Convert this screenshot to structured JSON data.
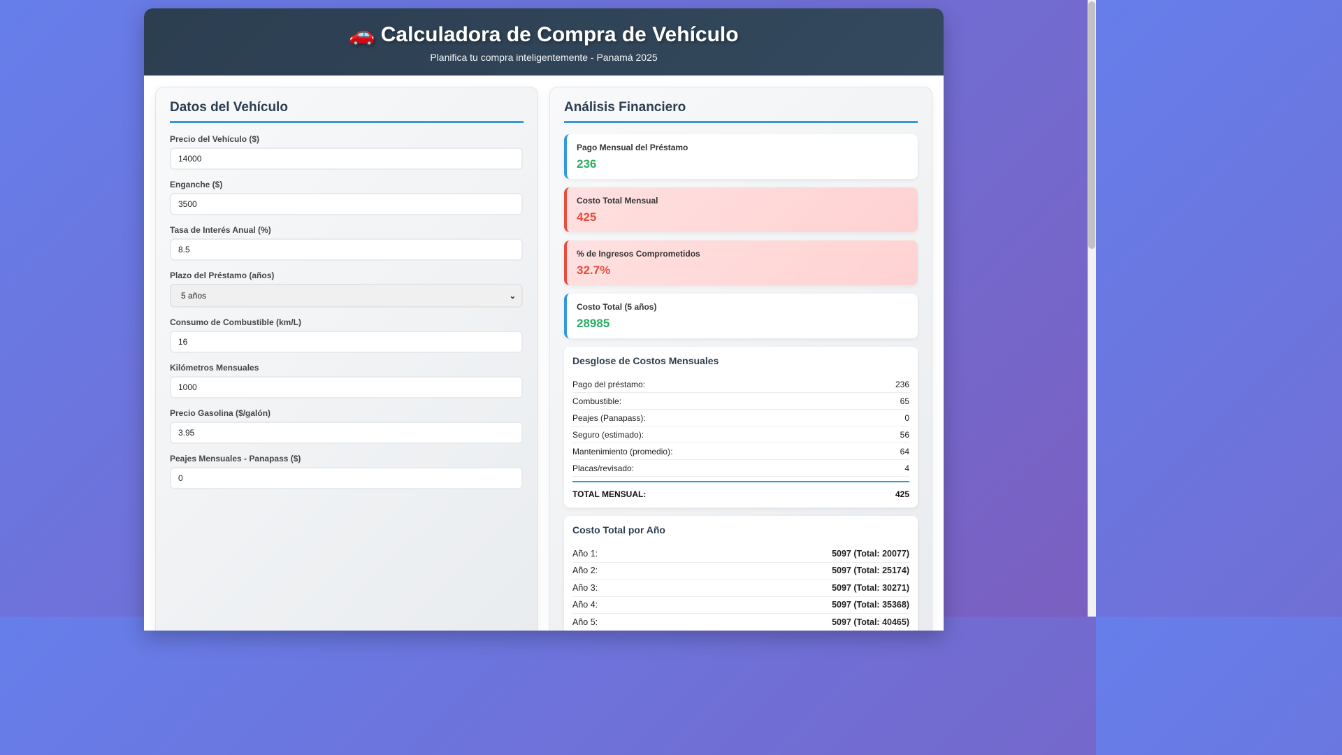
{
  "header": {
    "icon": "car-icon",
    "title": "Calculadora de Compra de Vehículo",
    "subtitle": "Planifica tu compra inteligentemente - Panamá 2025"
  },
  "vehicle_panel": {
    "heading": "Datos del Vehículo",
    "fields": [
      {
        "label": "Precio del Vehículo ($)",
        "value": "14000"
      },
      {
        "label": "Enganche ($)",
        "value": "3500"
      },
      {
        "label": "Tasa de Interés Anual (%)",
        "value": "8.5"
      },
      {
        "label": "Plazo del Préstamo (años)",
        "value": "5 años"
      },
      {
        "label": "Consumo de Combustible (km/L)",
        "value": "16"
      },
      {
        "label": "Kilómetros Mensuales",
        "value": "1000"
      },
      {
        "label": "Precio Gasolina ($/galón)",
        "value": "3.95"
      },
      {
        "label": "Peajes Mensuales - Panapass ($)",
        "value": "0"
      }
    ]
  },
  "analysis_panel": {
    "heading": "Análisis Financiero",
    "cards": [
      {
        "title": "Pago Mensual del Préstamo",
        "value": "236"
      },
      {
        "title": "Costo Total Mensual",
        "value": "425"
      },
      {
        "title": "% de Ingresos Comprometidos",
        "value": "32.7%"
      },
      {
        "title": "Costo Total (5 años)",
        "value": "28985"
      }
    ],
    "breakdown": {
      "heading": "Desglose de Costos Mensuales",
      "rows": [
        {
          "label": "Pago del préstamo:",
          "value": "236"
        },
        {
          "label": "Combustible:",
          "value": "65"
        },
        {
          "label": "Peajes (Panapass):",
          "value": "0"
        },
        {
          "label": "Seguro (estimado):",
          "value": "56"
        },
        {
          "label": "Mantenimiento (promedio):",
          "value": "64"
        },
        {
          "label": "Placas/revisado:",
          "value": "4"
        }
      ],
      "total_label": "TOTAL MENSUAL:",
      "total_value": "425"
    },
    "yearly": {
      "heading": "Costo Total por Año",
      "rows": [
        {
          "label": "Año 1:",
          "value": "5097 (Total: 20077)"
        },
        {
          "label": "Año 2:",
          "value": "5097 (Total: 25174)"
        },
        {
          "label": "Año 3:",
          "value": "5097 (Total: 30271)"
        },
        {
          "label": "Año 4:",
          "value": "5097 (Total: 35368)"
        },
        {
          "label": "Año 5:",
          "value": "5097 (Total: 40465)"
        }
      ]
    }
  }
}
